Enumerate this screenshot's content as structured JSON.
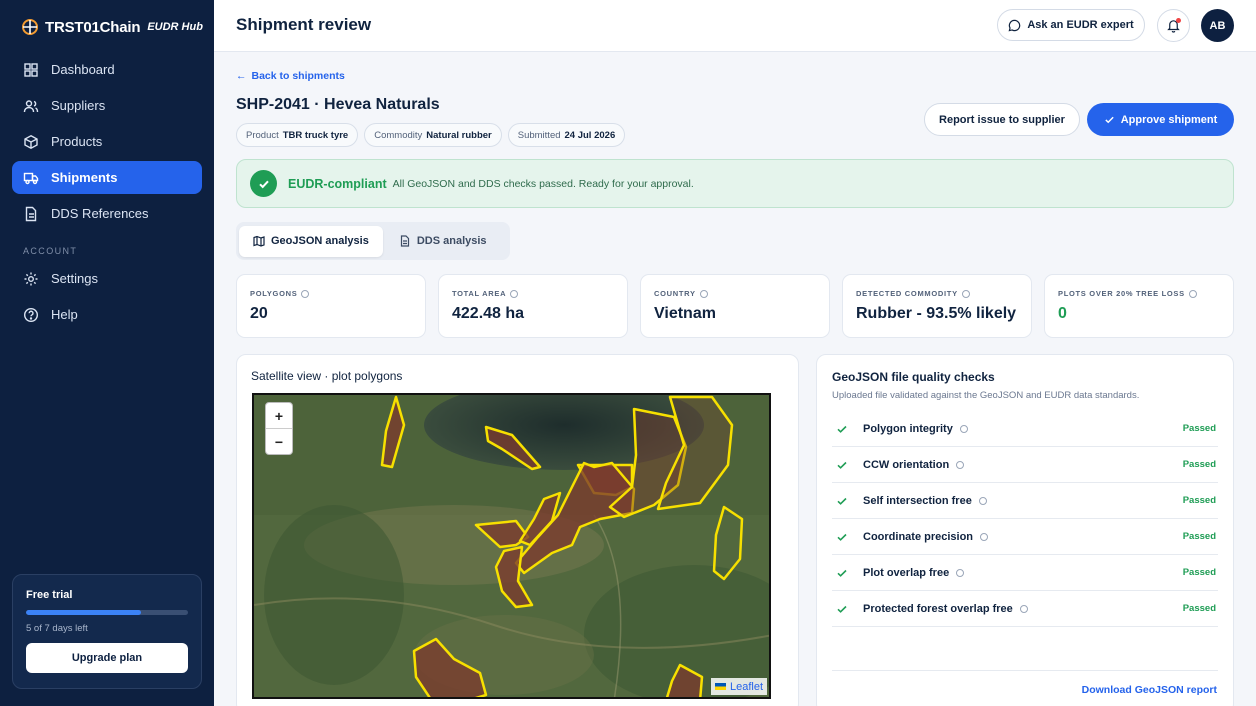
{
  "brand": {
    "name": "TRST01Chain",
    "sub": "EUDR Hub"
  },
  "sidebar": {
    "items": [
      {
        "label": "Dashboard",
        "icon": "grid-icon"
      },
      {
        "label": "Suppliers",
        "icon": "users-icon"
      },
      {
        "label": "Products",
        "icon": "box-icon"
      },
      {
        "label": "Shipments",
        "icon": "truck-icon",
        "active": true
      },
      {
        "label": "DDS References",
        "icon": "document-icon"
      }
    ],
    "section_label": "ACCOUNT",
    "account_items": [
      {
        "label": "Settings",
        "icon": "gear-icon"
      },
      {
        "label": "Help",
        "icon": "help-icon"
      }
    ],
    "trial": {
      "title": "Free trial",
      "progress": 0.71,
      "days_left": "5 of 7 days left",
      "button": "Upgrade plan"
    }
  },
  "header": {
    "title": "Shipment review",
    "expert_button": "Ask an EUDR expert",
    "avatar_initials": "AB"
  },
  "shipment": {
    "back_label": "Back to shipments",
    "title": "SHP-2041 · Hevea Naturals",
    "chips": [
      {
        "key": "Product",
        "value": "TBR truck tyre"
      },
      {
        "key": "Commodity",
        "value": "Natural rubber"
      },
      {
        "key": "Submitted",
        "value": "24 Jul 2026"
      }
    ],
    "report_button": "Report issue to supplier",
    "approve_button": "Approve shipment"
  },
  "banner": {
    "title": "EUDR-compliant",
    "text": "All GeoJSON and DDS checks passed. Ready for your approval."
  },
  "tabs": [
    {
      "label": "GeoJSON analysis",
      "active": true
    },
    {
      "label": "DDS analysis",
      "active": false
    }
  ],
  "stats": [
    {
      "label": "POLYGONS",
      "value": "20"
    },
    {
      "label": "TOTAL AREA",
      "value": "422.48 ha"
    },
    {
      "label": "COUNTRY",
      "value": "Vietnam"
    },
    {
      "label": "DETECTED COMMODITY",
      "value": "Rubber - 93.5% likely"
    },
    {
      "label": "PLOTS OVER 20% TREE LOSS",
      "value": "0",
      "color": "#1f9d55"
    }
  ],
  "map": {
    "title": "Satellite view · plot polygons",
    "zoom_in": "+",
    "zoom_out": "−",
    "attribution": "Leaflet"
  },
  "quality": {
    "title": "GeoJSON file quality checks",
    "subtitle": "Uploaded file validated against the GeoJSON and EUDR data standards.",
    "checks": [
      {
        "name": "Polygon integrity",
        "status": "Passed"
      },
      {
        "name": "CCW orientation",
        "status": "Passed"
      },
      {
        "name": "Self intersection free",
        "status": "Passed"
      },
      {
        "name": "Coordinate precision",
        "status": "Passed"
      },
      {
        "name": "Plot overlap free",
        "status": "Passed"
      },
      {
        "name": "Protected forest overlap free",
        "status": "Passed"
      }
    ],
    "download_label": "Download GeoJSON report"
  },
  "colors": {
    "accent": "#2563eb",
    "sidebar": "#0d2040",
    "success": "#1f9d55",
    "polygon_stroke": "#f7e000"
  }
}
